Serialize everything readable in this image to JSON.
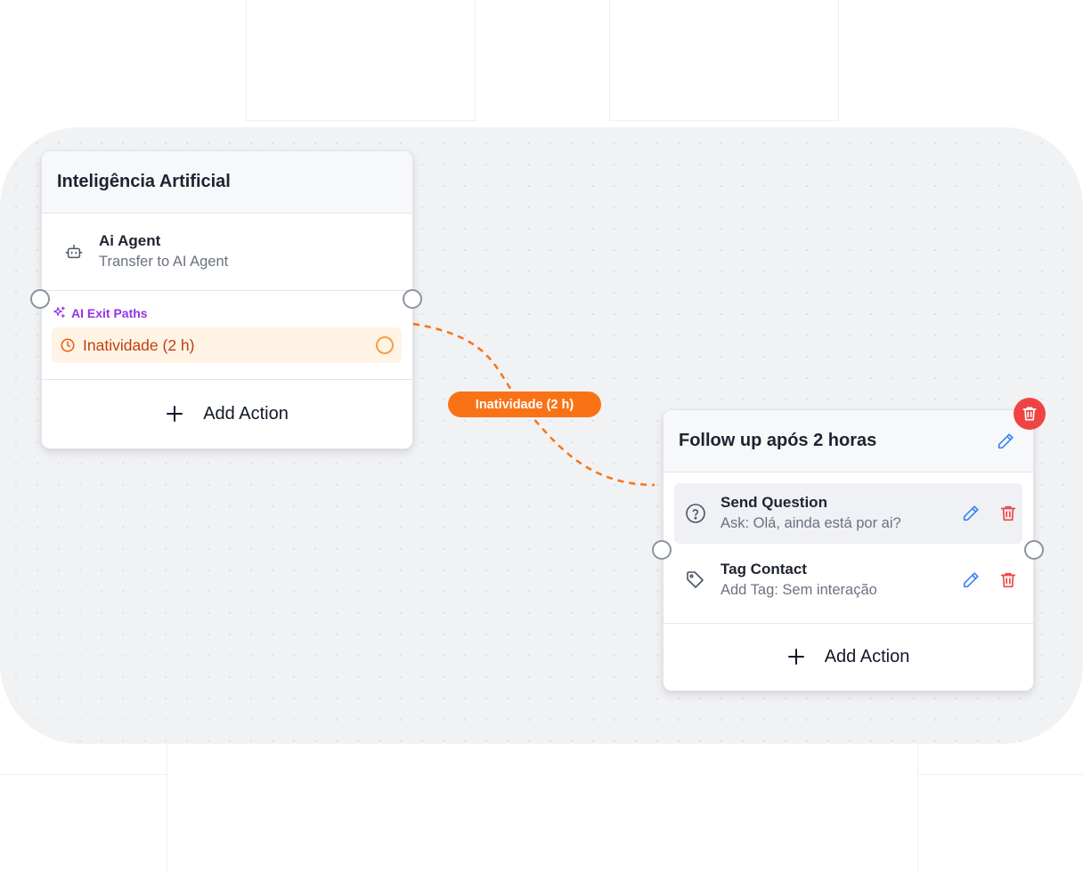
{
  "colors": {
    "canvas": "#f1f2f4",
    "edge": "#f97316",
    "ai_accent": "#9333ea",
    "exit_path_bg": "#fff3e6",
    "exit_path_text": "#c2410c",
    "edit_blue": "#3b82f6",
    "delete_red": "#ef4444"
  },
  "node_ai": {
    "title": "Inteligência Artificial",
    "action": {
      "icon": "robot-icon",
      "title": "Ai Agent",
      "subtitle": "Transfer to AI Agent"
    },
    "exit_paths_label": "AI Exit Paths",
    "exit_paths": [
      {
        "icon": "clock-icon",
        "label": "Inatividade (2 h)"
      }
    ],
    "add_action_label": "Add Action"
  },
  "edge": {
    "label": "Inatividade (2 h)"
  },
  "node_followup": {
    "title": "Follow up após 2 horas",
    "actions": [
      {
        "icon": "question-circle-icon",
        "title": "Send Question",
        "subtitle": "Ask: Olá, ainda está por ai?"
      },
      {
        "icon": "tag-icon",
        "title": "Tag Contact",
        "subtitle": "Add Tag: Sem interação"
      }
    ],
    "add_action_label": "Add Action"
  }
}
